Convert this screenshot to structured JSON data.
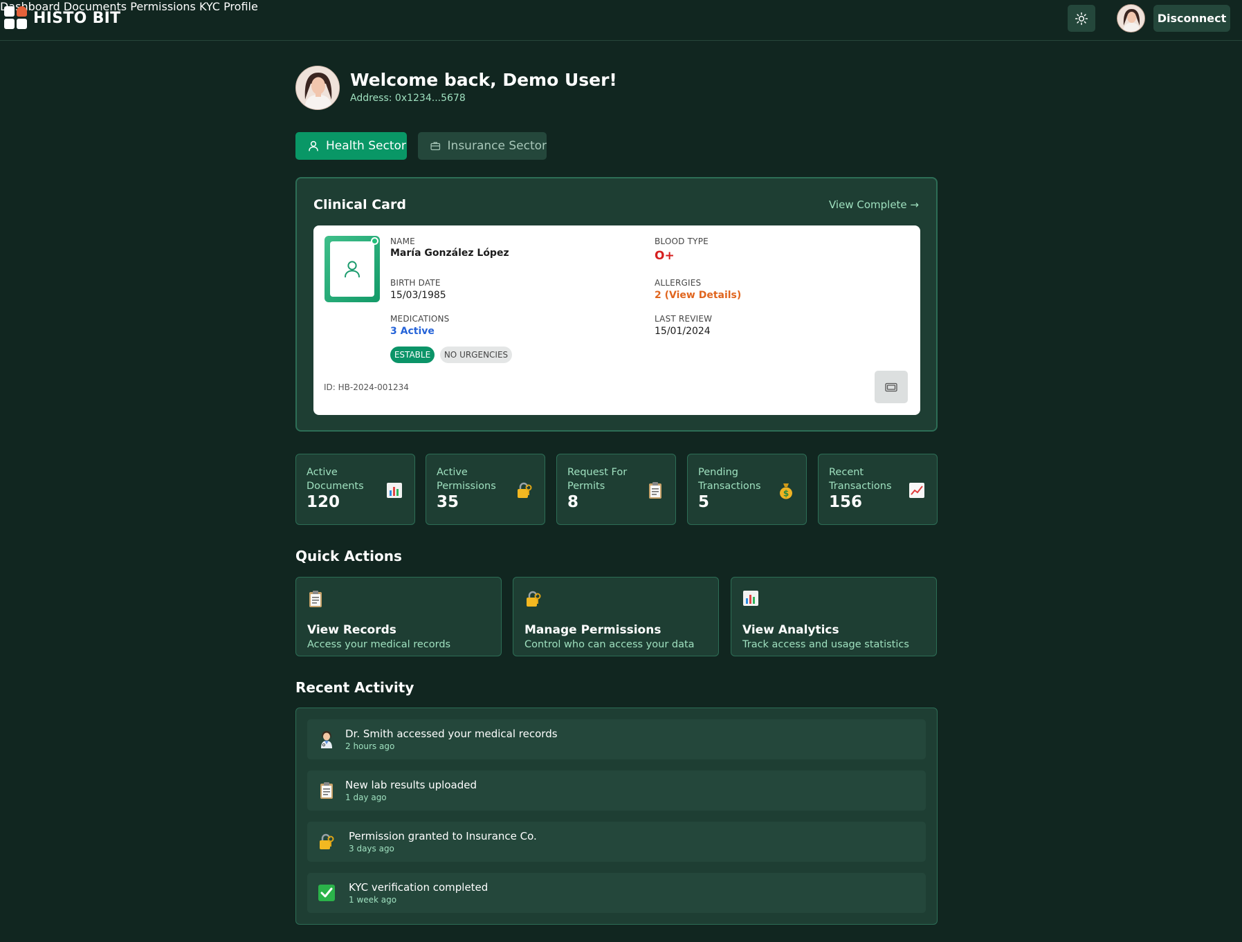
{
  "app": {
    "name": "HISTO BIT",
    "nav": [
      "Dashboard",
      "Documents",
      "Permissions",
      "KYC",
      "Profile"
    ],
    "disconnect_label": "Disconnect"
  },
  "welcome": {
    "title": "Welcome back, Demo User!",
    "address": "Address: 0x1234...5678"
  },
  "sectors": {
    "health": "Health Sector",
    "insurance": "Insurance Sector"
  },
  "clinical_card": {
    "title": "Clinical Card",
    "view_complete": "View Complete →",
    "name_label": "NAME",
    "name": "María González López",
    "blood_label": "BLOOD TYPE",
    "blood": "O+",
    "birth_label": "BIRTH DATE",
    "birth": "15/03/1985",
    "allergies_label": "ALLERGIES",
    "allergies": "2 (View Details)",
    "meds_label": "MEDICATIONS",
    "meds": "3 Active",
    "review_label": "LAST REVIEW",
    "review": "15/01/2024",
    "badge_status": "ESTABLE",
    "badge_urgency": "NO URGENCIES",
    "id": "ID: HB-2024-001234"
  },
  "stats": [
    {
      "label": "Active Documents",
      "value": "120",
      "icon": "bar-chart-icon"
    },
    {
      "label": "Active Permissions",
      "value": "35",
      "icon": "lock-key-icon"
    },
    {
      "label": "Request For Permits",
      "value": "8",
      "icon": "clipboard-icon"
    },
    {
      "label": "Pending Transactions",
      "value": "5",
      "icon": "money-bag-icon"
    },
    {
      "label": "Recent Transactions",
      "value": "156",
      "icon": "trend-up-icon"
    }
  ],
  "quick_actions": {
    "title": "Quick Actions",
    "items": [
      {
        "title": "View Records",
        "desc": "Access your medical records",
        "icon": "clipboard-icon"
      },
      {
        "title": "Manage Permissions",
        "desc": "Control who can access your data",
        "icon": "lock-key-icon"
      },
      {
        "title": "View Analytics",
        "desc": "Track access and usage statistics",
        "icon": "bar-chart-icon"
      }
    ]
  },
  "activity": {
    "title": "Recent Activity",
    "items": [
      {
        "text": "Dr. Smith accessed your medical records",
        "time": "2 hours ago",
        "icon": "doctor-icon"
      },
      {
        "text": "New lab results uploaded",
        "time": "1 day ago",
        "icon": "clipboard-icon"
      },
      {
        "text": "Permission granted to Insurance Co.",
        "time": "3 days ago",
        "icon": "lock-key-icon"
      },
      {
        "text": "KYC verification completed",
        "time": "1 week ago",
        "icon": "check-mark-icon"
      }
    ]
  },
  "colors": {
    "background": "#112620",
    "card": "#1e3e33",
    "accent": "#099766",
    "muted_text": "#9fe0bf",
    "blood": "#d61f1f",
    "allergies": "#e0651e",
    "meds": "#2563d8"
  }
}
